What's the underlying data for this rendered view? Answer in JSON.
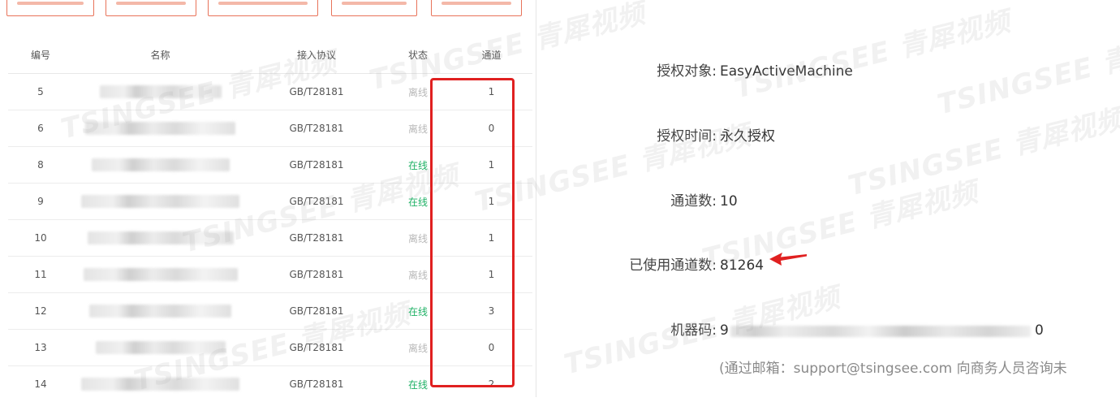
{
  "devices_table": {
    "columns": {
      "id": "编号",
      "name": "名称",
      "protocol": "接入协议",
      "status": "状态",
      "channels": "通道"
    },
    "rows": [
      {
        "id": "5",
        "protocol": "GB/T28181",
        "status": "离线",
        "online": false,
        "channels": "1"
      },
      {
        "id": "6",
        "protocol": "GB/T28181",
        "status": "离线",
        "online": false,
        "channels": "0"
      },
      {
        "id": "8",
        "protocol": "GB/T28181",
        "status": "在线",
        "online": true,
        "channels": "1"
      },
      {
        "id": "9",
        "protocol": "GB/T28181",
        "status": "在线",
        "online": true,
        "channels": "1"
      },
      {
        "id": "10",
        "protocol": "GB/T28181",
        "status": "离线",
        "online": false,
        "channels": "1"
      },
      {
        "id": "11",
        "protocol": "GB/T28181",
        "status": "离线",
        "online": false,
        "channels": "1"
      },
      {
        "id": "12",
        "protocol": "GB/T28181",
        "status": "在线",
        "online": true,
        "channels": "3"
      },
      {
        "id": "13",
        "protocol": "GB/T28181",
        "status": "离线",
        "online": false,
        "channels": "0"
      },
      {
        "id": "14",
        "protocol": "GB/T28181",
        "status": "在线",
        "online": true,
        "channels": "2"
      }
    ]
  },
  "license_info": {
    "target_label": "授权对象:",
    "target_value": "EasyActiveMachine",
    "time_label": "授权时间:",
    "time_value": "永久授权",
    "channels_label": "通道数:",
    "channels_value": "10",
    "used_label": "已使用通道数:",
    "used_value": "81264",
    "machine_label": "机器码:",
    "machine_prefix": "9",
    "machine_suffix": "0",
    "email_note": "(通过邮箱：support@tsingsee.com 向商务人员咨询未"
  },
  "watermark_texts": [
    "TSINGSEE 青犀视频",
    "TSINGSEE 青犀视频",
    "TSINGSEE 青犀视频",
    "TSINGSEE 青犀视频",
    "TSINGSEE 青犀视频",
    "TSINGSEE 青犀视频",
    "TSINGSEE 青犀视频",
    "TSINGSEE 青犀视频",
    "TSINGSEE 青犀视频",
    "TSINGSEE 青犀视频"
  ],
  "colors": {
    "online": "#1fb165",
    "offline": "#b8b8b8",
    "highlight": "#e02020",
    "button_border": "#e8735a"
  }
}
